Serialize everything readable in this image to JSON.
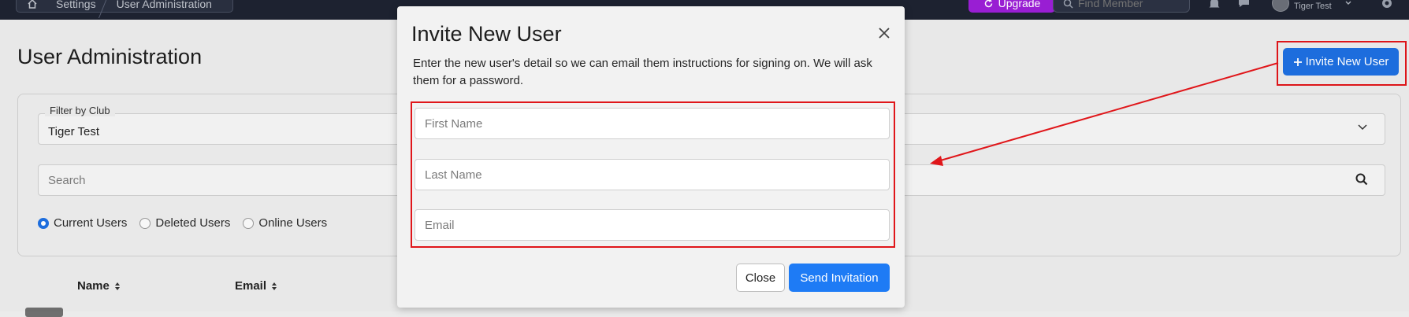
{
  "topbar": {
    "breadcrumbs": [
      "Settings",
      "User Administration"
    ],
    "upgrade_label": "Upgrade",
    "find_member_placeholder": "Find Member",
    "user_club": "Tiger Test"
  },
  "page": {
    "title": "User Administration",
    "invite_button_label": "Invite New User",
    "filter": {
      "legend": "Filter by Club",
      "selected_club": "Tiger Test",
      "search_placeholder": "Search",
      "radios": [
        {
          "label": "Current Users",
          "checked": true
        },
        {
          "label": "Deleted Users",
          "checked": false
        },
        {
          "label": "Online Users",
          "checked": false
        }
      ]
    },
    "table": {
      "columns": [
        "Name",
        "Email"
      ]
    }
  },
  "modal": {
    "title": "Invite New User",
    "description": "Enter the new user's detail so we can email them instructions for signing on. We will ask them for a password.",
    "fields": {
      "first_name_placeholder": "First Name",
      "last_name_placeholder": "Last Name",
      "email_placeholder": "Email"
    },
    "close_label": "Close",
    "send_label": "Send Invitation"
  },
  "colors": {
    "primary": "#1e6fe0",
    "annotation": "#e0161a",
    "navbar": "#1e2331",
    "upgrade": "#9b1fd6"
  }
}
